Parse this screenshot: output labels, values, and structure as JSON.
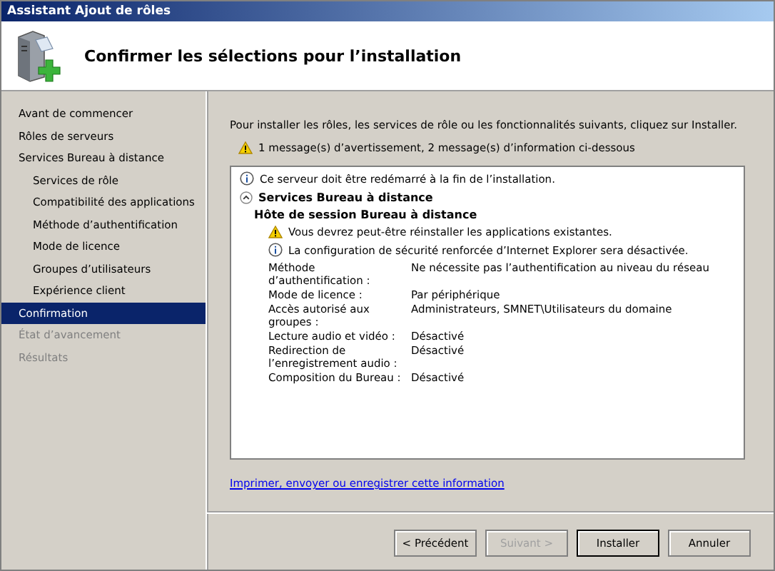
{
  "window": {
    "title": "Assistant Ajout de rôles"
  },
  "header": {
    "title": "Confirmer les sélections pour l’installation"
  },
  "sidebar": {
    "items": [
      {
        "label": "Avant de commencer",
        "selected": false,
        "disabled": false
      },
      {
        "label": "Rôles de serveurs",
        "selected": false,
        "disabled": false
      },
      {
        "label": "Services Bureau à distance",
        "selected": false,
        "disabled": false,
        "children": [
          {
            "label": "Services de rôle",
            "selected": false,
            "disabled": false
          },
          {
            "label": "Compatibilité des applications",
            "selected": false,
            "disabled": false
          },
          {
            "label": "Méthode d’authentification",
            "selected": false,
            "disabled": false
          },
          {
            "label": "Mode de licence",
            "selected": false,
            "disabled": false
          },
          {
            "label": "Groupes d’utilisateurs",
            "selected": false,
            "disabled": false
          },
          {
            "label": "Expérience client",
            "selected": false,
            "disabled": false
          }
        ]
      },
      {
        "label": "Confirmation",
        "selected": true,
        "disabled": false
      },
      {
        "label": "État d’avancement",
        "selected": false,
        "disabled": true
      },
      {
        "label": "Résultats",
        "selected": false,
        "disabled": true
      }
    ]
  },
  "intro": "Pour installer les rôles, les services de rôle ou les fonctionnalités suivants, cliquez sur Installer.",
  "summary": {
    "kind": "warning",
    "text": "1 message(s) d’avertissement, 2 message(s) d’information ci-dessous"
  },
  "details": {
    "top_message": {
      "kind": "info",
      "text": "Ce serveur doit être redémarré à la fin de l’installation."
    },
    "section": {
      "title": "Services Bureau à distance",
      "expanded": true,
      "subsection": "Hôte de session Bureau à distance",
      "messages": [
        {
          "kind": "warning",
          "text": "Vous devrez peut-être réinstaller les applications existantes."
        },
        {
          "kind": "info",
          "text": "La configuration de sécurité renforcée d’Internet Explorer sera désactivée."
        }
      ],
      "properties": [
        {
          "label": "Méthode d’authentification :",
          "value": "Ne nécessite pas l’authentification au niveau du réseau"
        },
        {
          "label": "Mode de licence  :",
          "value": "Par périphérique"
        },
        {
          "label": "Accès autorisé aux groupes :",
          "value": "Administrateurs, SMNET\\Utilisateurs du domaine"
        },
        {
          "label": "Lecture audio et vidéo :",
          "value": "Désactivé"
        },
        {
          "label": "Redirection de l’enregistrement audio :",
          "value": "Désactivé"
        },
        {
          "label": "Composition du Bureau :",
          "value": "Désactivé"
        }
      ]
    }
  },
  "link": "Imprimer, envoyer ou enregistrer cette information",
  "buttons": [
    {
      "label": "< Précédent",
      "disabled": false,
      "default": false
    },
    {
      "label": "Suivant >",
      "disabled": true,
      "default": false
    },
    {
      "label": "Installer",
      "disabled": false,
      "default": true
    },
    {
      "label": "Annuler",
      "disabled": false,
      "default": false
    }
  ]
}
